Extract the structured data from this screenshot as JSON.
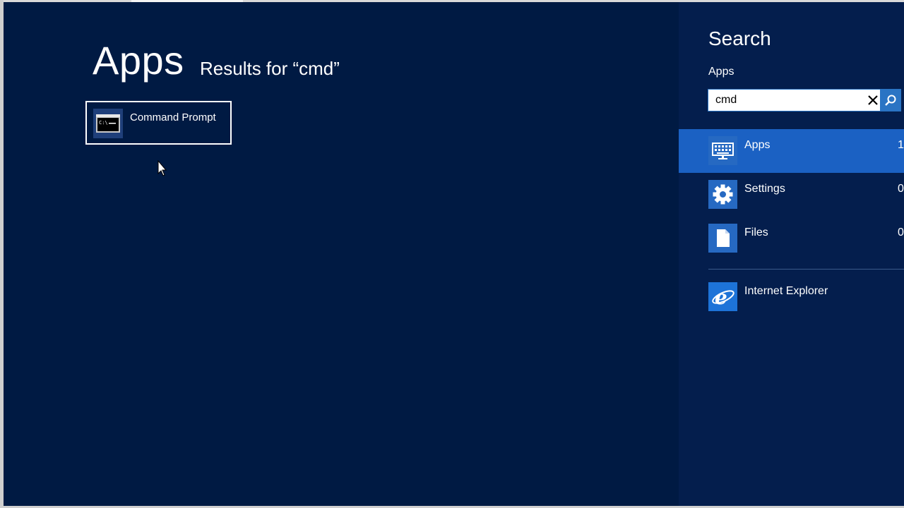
{
  "main": {
    "heading": "Apps",
    "results_for": "Results for “cmd”",
    "results": [
      {
        "label": "Command Prompt",
        "icon": "command-prompt-icon"
      }
    ]
  },
  "search_pane": {
    "title": "Search",
    "scope": "Apps",
    "query": "cmd",
    "scopes": [
      {
        "label": "Apps",
        "count": "1",
        "icon": "apps-keyboard-icon",
        "selected": true
      },
      {
        "label": "Settings",
        "count": "0",
        "icon": "settings-gear-icon"
      },
      {
        "label": "Files",
        "count": "0",
        "icon": "file-icon"
      }
    ],
    "apps": [
      {
        "label": "Internet Explorer",
        "icon": "internet-explorer-icon"
      }
    ]
  },
  "colors": {
    "background": "#001a43",
    "charm_background": "#041e4d",
    "accent": "#1b61c3"
  }
}
